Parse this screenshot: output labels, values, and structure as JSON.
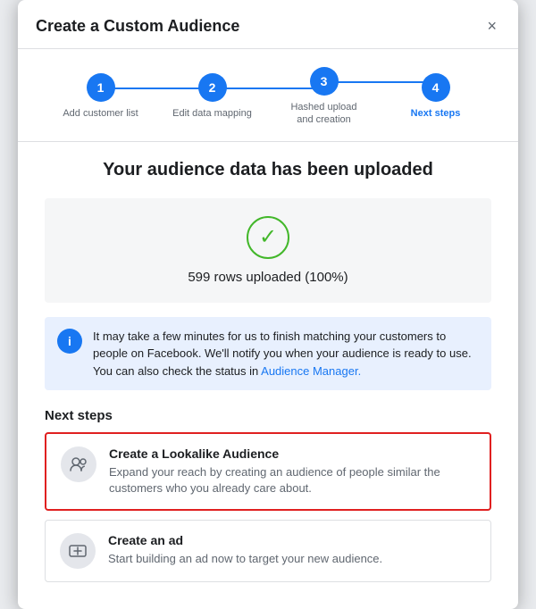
{
  "modal": {
    "title": "Create a Custom Audience",
    "close_label": "×"
  },
  "stepper": {
    "steps": [
      {
        "number": "1",
        "label": "Add customer list",
        "active": false
      },
      {
        "number": "2",
        "label": "Edit data mapping",
        "active": false
      },
      {
        "number": "3",
        "label": "Hashed upload and creation",
        "active": false
      },
      {
        "number": "4",
        "label": "Next steps",
        "active": true
      }
    ]
  },
  "upload": {
    "title": "Your audience data has been uploaded",
    "count_text": "599 rows uploaded (100%)"
  },
  "info": {
    "message": "It may take a few minutes for us to finish matching your customers to people on Facebook. We'll notify you when your audience is ready to use. You can also check the status in ",
    "link_text": "Audience Manager.",
    "icon": "i"
  },
  "next_steps": {
    "section_label": "Next steps",
    "cards": [
      {
        "title": "Create a Lookalike Audience",
        "description": "Expand your reach by creating an audience of people similar the customers who you already care about.",
        "highlighted": true
      },
      {
        "title": "Create an ad",
        "description": "Start building an ad now to target your new audience.",
        "highlighted": false
      }
    ]
  }
}
